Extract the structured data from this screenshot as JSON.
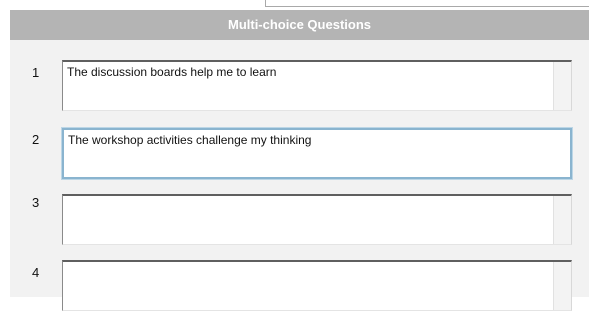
{
  "header": {
    "title": "Multi-choice Questions"
  },
  "questions": [
    {
      "number": "1",
      "text": "The discussion boards help me to learn"
    },
    {
      "number": "2",
      "text": "The workshop activities challenge my thinking"
    },
    {
      "number": "3",
      "text": ""
    },
    {
      "number": "4",
      "text": ""
    }
  ]
}
